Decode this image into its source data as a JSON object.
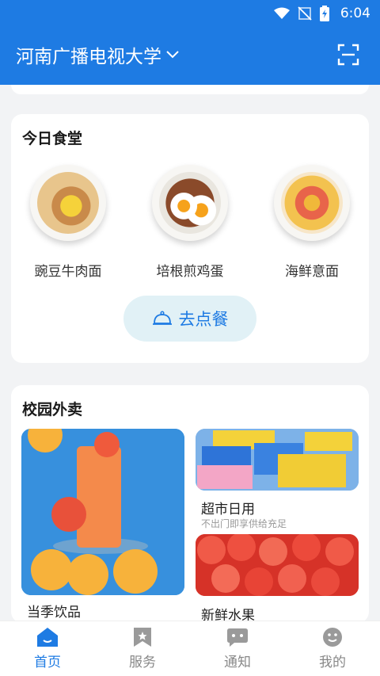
{
  "status_bar": {
    "time": "6:04"
  },
  "header": {
    "school_name": "河南广播电视大学"
  },
  "canteen": {
    "title": "今日食堂",
    "dishes": [
      {
        "name": "豌豆牛肉面"
      },
      {
        "name": "培根煎鸡蛋"
      },
      {
        "name": "海鲜意面"
      }
    ],
    "order_button": "去点餐"
  },
  "delivery": {
    "title": "校园外卖",
    "tiles": [
      {
        "label": "当季饮品"
      },
      {
        "label": "超市日用",
        "subtitle": "不出门即享供给充足"
      },
      {
        "label": "新鲜水果"
      }
    ]
  },
  "tabbar": {
    "tabs": [
      {
        "label": "首页",
        "icon": "home-icon",
        "active": true
      },
      {
        "label": "服务",
        "icon": "bookmark-icon",
        "active": false
      },
      {
        "label": "通知",
        "icon": "chat-icon",
        "active": false
      },
      {
        "label": "我的",
        "icon": "smile-icon",
        "active": false
      }
    ]
  },
  "colors": {
    "primary": "#1e7be3",
    "background": "#f2f3f5",
    "order_button_bg": "#e1f1f6"
  }
}
